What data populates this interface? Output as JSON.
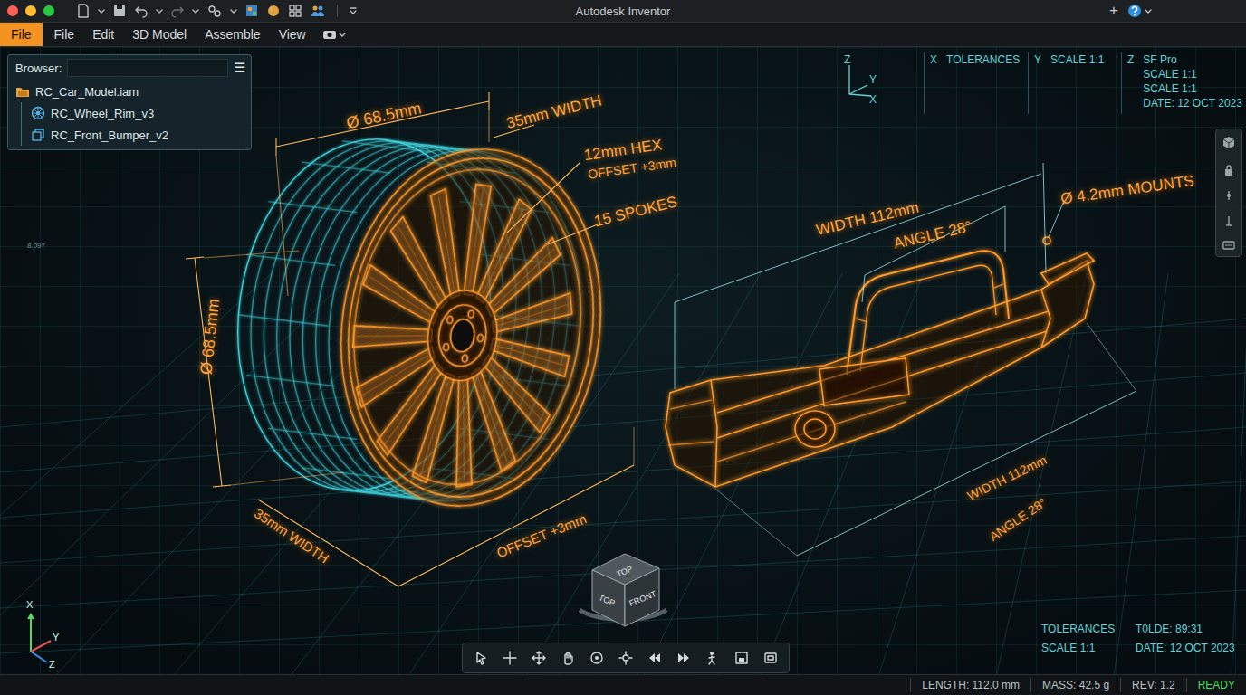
{
  "window": {
    "title": "Autodesk Inventor"
  },
  "title_bar": {
    "new_tab": "+"
  },
  "menu": [
    {
      "label": "File",
      "selected": true
    },
    {
      "label": "File",
      "selected": false
    },
    {
      "label": "Edit",
      "selected": false
    },
    {
      "label": "3D Model",
      "selected": false
    },
    {
      "label": "Assemble",
      "selected": false
    },
    {
      "label": "View",
      "selected": false
    }
  ],
  "browser": {
    "title": "Browser:",
    "menu_icon": "☰",
    "items": [
      {
        "label": "RC_Car_Model.iam",
        "kind": "assembly"
      },
      {
        "label": "RC_Wheel_Rim_v3",
        "kind": "part"
      },
      {
        "label": "RC_Front_Bumper_v2",
        "kind": "component"
      }
    ]
  },
  "info_panel": {
    "axes": [
      "Z",
      "Y",
      "X"
    ],
    "columns": [
      {
        "axis": "X",
        "lines": [
          "TOLERANCES"
        ]
      },
      {
        "axis": "Y",
        "lines": [
          "SCALE 1:1"
        ]
      },
      {
        "axis": "Z",
        "lines": [
          "SF Pro",
          "SCALE 1:1",
          "SCALE 1:1",
          "DATE: 12 OCT 2023"
        ]
      }
    ]
  },
  "grid_labels": [
    "8.097"
  ],
  "wheel_labels": [
    "Ø 68.5mm",
    "35mm WIDTH",
    "12mm HEX",
    "OFFSET +3mm",
    "15 SPOKES",
    "Ø 68.5mm",
    "35mm WIDTH",
    "OFFSET +3mm"
  ],
  "bumper_labels": [
    "WIDTH 112mm",
    "ANGLE 28°",
    "Ø 4.2mm MOUNTS",
    "WIDTH 112mm",
    "ANGLE 28°"
  ],
  "view_cube": {
    "faces": [
      "TOP",
      "TOP",
      "FRONT"
    ]
  },
  "corner_axes": [
    "X",
    "Y",
    "Z"
  ],
  "summary": [
    "TOLERANCES",
    "T0LDE: 89:31",
    "SCALE 1:1",
    "DATE: 12 OCT 2023"
  ],
  "status_bar": {
    "items": [
      "LENGTH: 112.0 mm",
      "MASS: 42.5 g",
      "REV: 1.2"
    ],
    "state": "READY"
  }
}
